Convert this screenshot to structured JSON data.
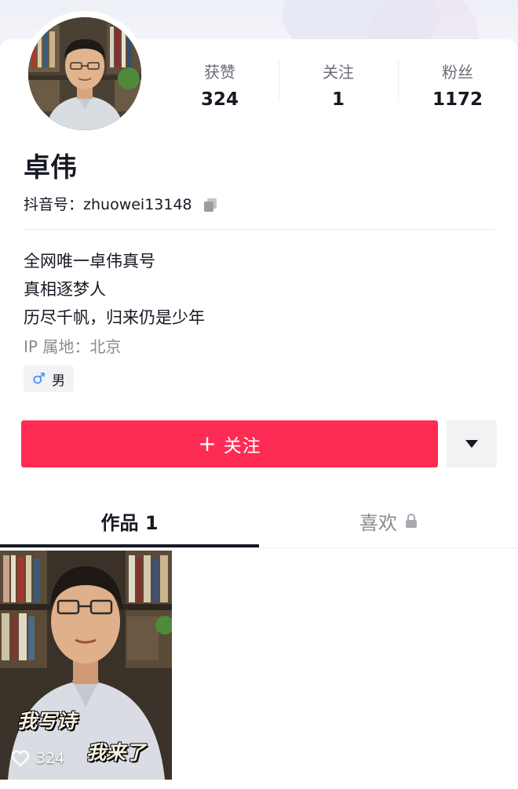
{
  "profile": {
    "name": "卓伟",
    "id_label": "抖音号：",
    "id_value": "zhuowei13148",
    "bio": [
      "全网唯一卓伟真号",
      "真相逐梦人",
      "历尽千帆，归来仍是少年"
    ],
    "ip_location": "IP 属地：北京",
    "gender": "男"
  },
  "stats": [
    {
      "label": "获赞",
      "value": "324"
    },
    {
      "label": "关注",
      "value": "1"
    },
    {
      "label": "粉丝",
      "value": "1172"
    }
  ],
  "actions": {
    "follow_label": "关注",
    "follow_plus": "+"
  },
  "tabs": {
    "works_label": "作品 1",
    "likes_label": "喜欢"
  },
  "videos": [
    {
      "caption_line1": "我写诗",
      "caption_line2": "我来了",
      "likes": "324"
    }
  ],
  "colors": {
    "accent": "#fe2c55",
    "text_primary": "#161823",
    "text_secondary": "#8a8b91",
    "gender_male": "#3a86ff"
  },
  "icons": {
    "copy": "copy-icon",
    "dropdown": "caret-down-icon",
    "lock": "lock-icon",
    "like": "heart-outline-icon",
    "gender": "male-symbol-icon"
  }
}
